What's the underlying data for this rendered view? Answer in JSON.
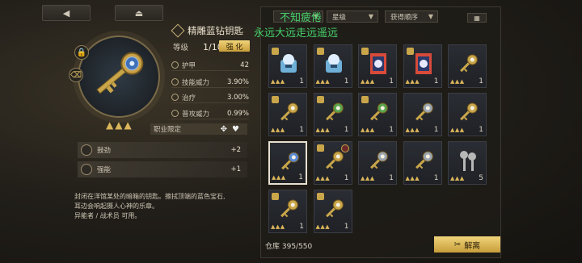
{
  "nav": {
    "back_icon": "triangle-left-icon",
    "menu_icon": "eject-icon"
  },
  "item": {
    "name": "精雕蓝钻钥匙",
    "level_label": "等级",
    "level_value": "1/10",
    "upgrade_label": "强 化",
    "stats": [
      {
        "name": "护甲",
        "value": "42",
        "icon": "shield-icon"
      },
      {
        "name": "技能威力",
        "value": "3.90%",
        "icon": "skill-icon"
      },
      {
        "name": "治疗",
        "value": "3.00%",
        "icon": "heart-icon"
      },
      {
        "name": "普攻威力",
        "value": "0.99%",
        "icon": "attack-icon"
      }
    ],
    "job_label": "职业限定",
    "skills": [
      {
        "name": "鼓劲",
        "value": "+2"
      },
      {
        "name": "强能",
        "value": "+1"
      }
    ],
    "description": [
      "封闭在洋馆某处的暗箱的钥匙。擦拭顶端的蓝色宝石,",
      "耳边会响起摄人心神的乐章。",
      "异能者 / 战术员 可用。"
    ]
  },
  "inventory": {
    "filters": [
      {
        "label": "",
        "caret": "▼"
      },
      {
        "label": "星级",
        "caret": "▼"
      },
      {
        "label": "获得顺序",
        "caret": "▼"
      }
    ],
    "layout_icon": "grid-icon",
    "storage_label": "仓库 395/550",
    "decompose_label": "解离",
    "items": [
      {
        "type": "chest",
        "count": "1",
        "locked": true,
        "color": "#6fb0d8"
      },
      {
        "type": "chest",
        "count": "1",
        "locked": true,
        "color": "#6fb0d8"
      },
      {
        "type": "card",
        "count": "1",
        "locked": true,
        "color": "#d84a3a"
      },
      {
        "type": "card",
        "count": "1",
        "locked": true,
        "color": "#d84a3a"
      },
      {
        "type": "key",
        "count": "1",
        "locked": false,
        "color": "#c9a64a"
      },
      {
        "type": "key",
        "count": "1",
        "locked": true,
        "color": "#c9a64a"
      },
      {
        "type": "key",
        "count": "1",
        "locked": true,
        "color": "#5aa34a"
      },
      {
        "type": "key",
        "count": "1",
        "locked": true,
        "color": "#5aa34a"
      },
      {
        "type": "key",
        "count": "1",
        "locked": false,
        "color": "#9aa5b0"
      },
      {
        "type": "key",
        "count": "1",
        "locked": false,
        "color": "#c9a64a"
      },
      {
        "type": "key",
        "count": "1",
        "locked": false,
        "color": "#5a8ad8",
        "selected": true
      },
      {
        "type": "key",
        "count": "1",
        "locked": true,
        "color": "#c9a64a",
        "badge": true
      },
      {
        "type": "key",
        "count": "1",
        "locked": false,
        "color": "#9aa5b0"
      },
      {
        "type": "key",
        "count": "1",
        "locked": false,
        "color": "#9aa5b0"
      },
      {
        "type": "keys",
        "count": "5",
        "locked": false,
        "color": "#b8b8b8"
      },
      {
        "type": "key",
        "count": "1",
        "locked": true,
        "color": "#c9a64a"
      },
      {
        "type": "key",
        "count": "1",
        "locked": true,
        "color": "#c9a64a"
      }
    ]
  },
  "watermark": {
    "line1": "不知疲倦",
    "line2": "永远大远走远遥远"
  }
}
